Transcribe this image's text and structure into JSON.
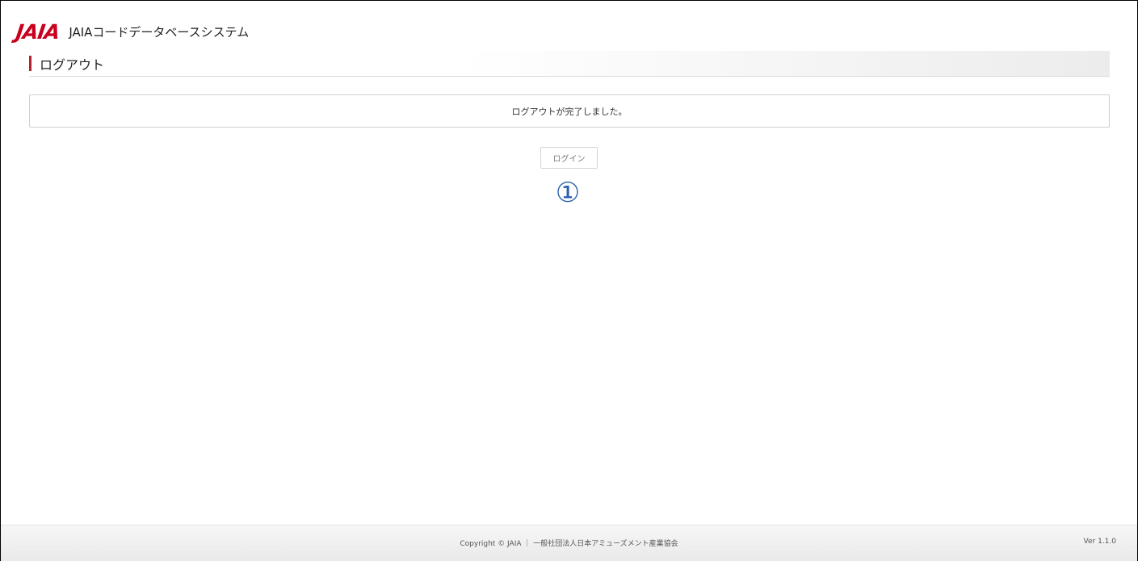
{
  "header": {
    "logo_text": "JAIA",
    "system_title": "JAIAコードデータベースシステム"
  },
  "page": {
    "heading": "ログアウト",
    "message": "ログアウトが完了しました。",
    "login_button_label": "ログイン",
    "annotation_marker": "①"
  },
  "footer": {
    "copyright": "Copyright © JAIA ｜ 一般社団法人日本アミューズメント産業協会",
    "version": "Ver 1.1.0"
  },
  "colors": {
    "brand_red": "#c8001e",
    "heading_accent": "#b5232a",
    "annotation_blue": "#2a5fad"
  }
}
